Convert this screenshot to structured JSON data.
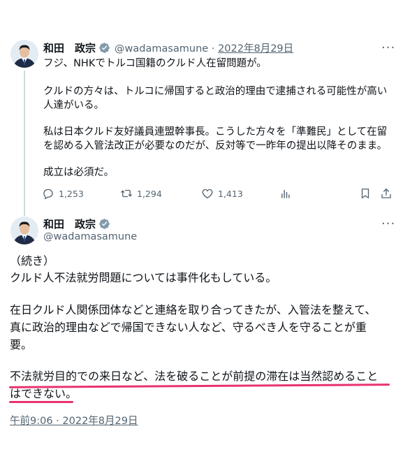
{
  "tweet1": {
    "name": "和田　政宗",
    "handle": "@wadamasamune",
    "separator": "·",
    "date": "2022年8月29日",
    "lines": [
      "フジ、NHKでトルコ国籍のクルド人在留問題が。",
      "クルドの方々は、トルコに帰国すると政治的理由で逮捕される可能性が高い",
      "人達がいる。",
      "私は日本クルド友好議員連盟幹事長。こうした方々を「準難民」として在留",
      "を認める入管法改正が必要なのだが、反対等で一昨年の提出以降そのまま。",
      "成立は必須だ。"
    ],
    "replies": "1,253",
    "retweets": "1,294",
    "likes": "1,413"
  },
  "tweet2": {
    "name": "和田　政宗",
    "handle": "@wadamasamune",
    "lines": [
      "（続き）",
      "クルド人不法就労問題については事件化もしている。",
      "在日クルド人関係団体などと連絡を取り合ってきたが、入管法を整えて、",
      "真に政治的理由などで帰国できない人など、守るべき人を守ることが重",
      "要。",
      "不法就労目的での来日など、法を破ることが前提の滞在は当然認めること",
      "はできない。"
    ],
    "timestamp": "午前9:06 · 2022年8月29日"
  },
  "colors": {
    "underline": "#e8336e",
    "verified": "#829aab",
    "muted": "#536471"
  },
  "icons": [
    "verified-badge-icon",
    "more-icon",
    "reply-icon",
    "retweet-icon",
    "like-icon",
    "views-icon",
    "bookmark-icon",
    "share-icon"
  ]
}
